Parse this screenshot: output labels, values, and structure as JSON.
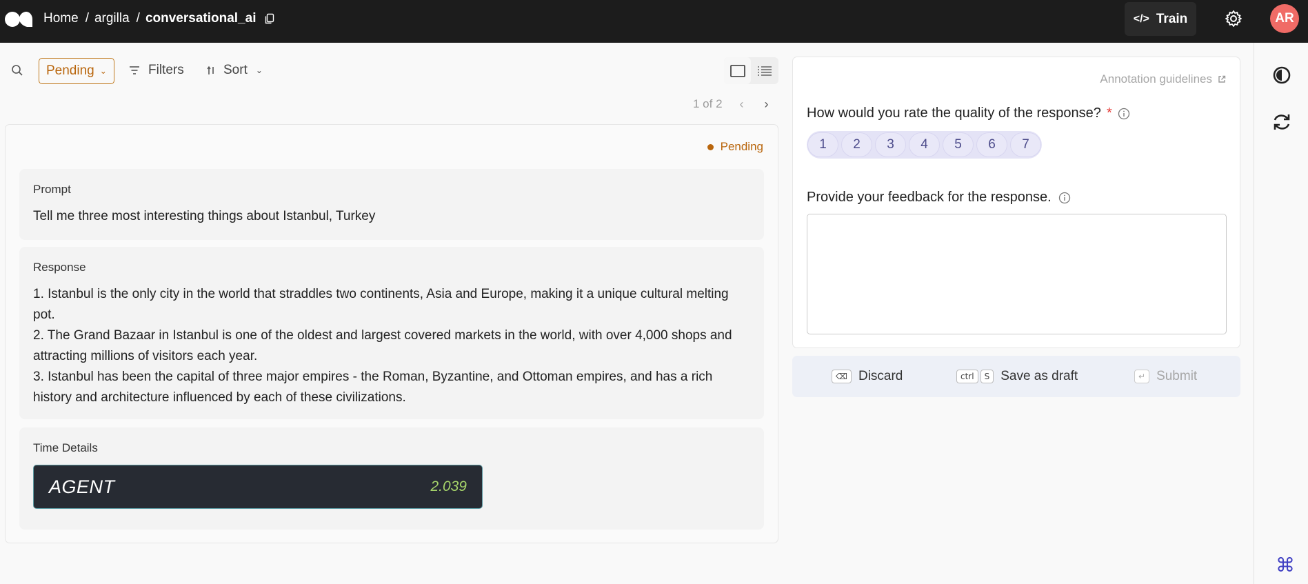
{
  "header": {
    "breadcrumbs": [
      "Home",
      "argilla",
      "conversational_ai"
    ],
    "separator": "/",
    "train_label": "Train",
    "avatar_initials": "AR"
  },
  "toolbar": {
    "status_filter": "Pending",
    "filters_label": "Filters",
    "sort_label": "Sort"
  },
  "pagination": {
    "text": "1 of 2"
  },
  "record": {
    "status": "Pending",
    "fields": {
      "prompt_label": "Prompt",
      "prompt_text": "Tell me three most interesting things about Istanbul, Turkey",
      "response_label": "Response",
      "response_lines": [
        "1. Istanbul is the only city in the world that straddles two continents, Asia and Europe, making it a unique cultural melting pot.",
        "2. The Grand Bazaar in Istanbul is one of the oldest and largest covered markets in the world, with over 4,000 shops and attracting millions of visitors each year.",
        "3. Istanbul has been the capital of three major empires - the Roman, Byzantine, and Ottoman empires, and has a rich history and architecture influenced by each of these civilizations."
      ],
      "time_label": "Time Details",
      "agent_name": "AGENT",
      "agent_value": "2.039"
    }
  },
  "annotation": {
    "guidelines_label": "Annotation guidelines",
    "rating_question": "How would you rate the quality of the response?",
    "required_mark": "*",
    "rating_options": [
      "1",
      "2",
      "3",
      "4",
      "5",
      "6",
      "7"
    ],
    "feedback_question": "Provide your feedback for the response.",
    "feedback_value": ""
  },
  "actions": {
    "discard_label": "Discard",
    "discard_key": "⌫",
    "draft_label": "Save as draft",
    "draft_keys": [
      "ctrl",
      "S"
    ],
    "submit_label": "Submit",
    "submit_key": "↵"
  },
  "colors": {
    "pending": "#b9660d",
    "accent": "#3f3fc3",
    "avatar": "#f06b66",
    "agent_value": "#a6d46a"
  }
}
